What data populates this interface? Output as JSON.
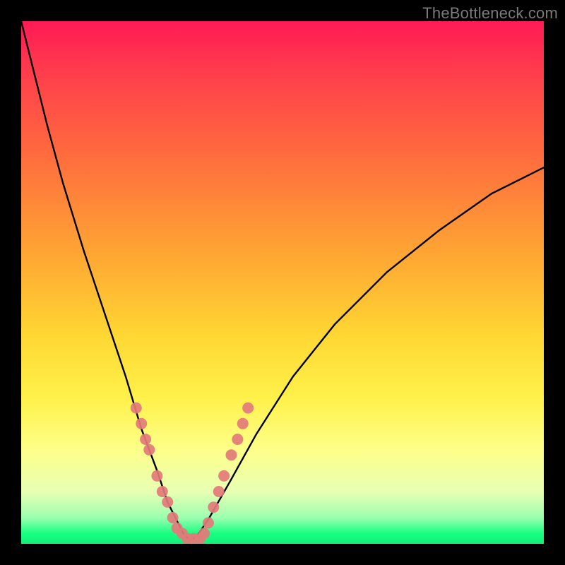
{
  "watermark": {
    "text": "TheBottleneck.com"
  },
  "chart_data": {
    "type": "line",
    "title": "",
    "xlabel": "",
    "ylabel": "",
    "xlim": [
      0,
      100
    ],
    "ylim": [
      0,
      100
    ],
    "background": {
      "gradient": "vertical",
      "stops": [
        {
          "pos": 0,
          "color": "#ff1a55"
        },
        {
          "pos": 25,
          "color": "#ff6a3e"
        },
        {
          "pos": 60,
          "color": "#ffd733"
        },
        {
          "pos": 82,
          "color": "#fdff89"
        },
        {
          "pos": 95,
          "color": "#9cffb0"
        },
        {
          "pos": 100,
          "color": "#11f07a"
        }
      ]
    },
    "series": [
      {
        "name": "bottleneck-curve",
        "color": "#000000",
        "x": [
          0,
          2,
          5,
          8,
          12,
          16,
          20,
          23,
          26,
          28,
          30,
          31,
          32,
          33,
          34,
          36,
          40,
          45,
          52,
          60,
          70,
          80,
          90,
          100
        ],
        "values": [
          100,
          92,
          80,
          69,
          56,
          44,
          32,
          22,
          14,
          8,
          4,
          2,
          1,
          1,
          2,
          5,
          12,
          21,
          32,
          42,
          52,
          60,
          67,
          72
        ]
      }
    ],
    "markers": [
      {
        "name": "left-cluster",
        "color": "#e37a7a",
        "points": [
          {
            "x": 22.0,
            "y": 26
          },
          {
            "x": 23.0,
            "y": 23
          },
          {
            "x": 23.8,
            "y": 20
          },
          {
            "x": 24.5,
            "y": 18
          },
          {
            "x": 26.0,
            "y": 13
          },
          {
            "x": 27.0,
            "y": 10
          },
          {
            "x": 28.0,
            "y": 8
          },
          {
            "x": 29.0,
            "y": 5
          },
          {
            "x": 29.8,
            "y": 3
          },
          {
            "x": 30.8,
            "y": 2
          }
        ]
      },
      {
        "name": "right-cluster",
        "color": "#e37a7a",
        "points": [
          {
            "x": 35.0,
            "y": 2
          },
          {
            "x": 35.8,
            "y": 4
          },
          {
            "x": 36.8,
            "y": 7
          },
          {
            "x": 37.8,
            "y": 10
          },
          {
            "x": 38.8,
            "y": 13
          },
          {
            "x": 40.2,
            "y": 17
          },
          {
            "x": 41.4,
            "y": 20
          },
          {
            "x": 42.4,
            "y": 23
          },
          {
            "x": 43.4,
            "y": 26
          }
        ]
      },
      {
        "name": "bottom-cluster",
        "color": "#e37a7a",
        "points": [
          {
            "x": 31.8,
            "y": 1
          },
          {
            "x": 33.0,
            "y": 1
          },
          {
            "x": 34.2,
            "y": 1
          }
        ]
      }
    ]
  }
}
